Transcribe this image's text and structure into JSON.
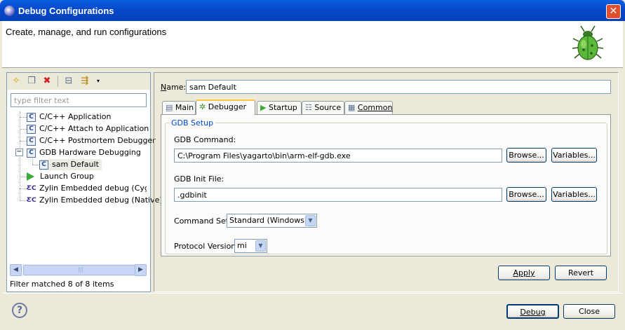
{
  "window": {
    "title": "Debug Configurations",
    "close_glyph": "✕"
  },
  "header": {
    "title": "Create, manage, and run configurations"
  },
  "left": {
    "filter_placeholder": "type filter text",
    "tree": [
      {
        "label": "C/C++ Application",
        "icon": "c-app-icon"
      },
      {
        "label": "C/C++ Attach to Application",
        "icon": "c-app-icon"
      },
      {
        "label": "C/C++ Postmortem Debugger",
        "icon": "c-app-icon"
      },
      {
        "label": "GDB Hardware Debugging",
        "icon": "c-app-icon",
        "expanded": true
      },
      {
        "label": "sam Default",
        "icon": "c-app-icon",
        "selected": true
      },
      {
        "label": "Launch Group",
        "icon": "launch-group-icon"
      },
      {
        "label": "Zylin Embedded debug (Cygwin)",
        "icon": "zylin-icon"
      },
      {
        "label": "Zylin Embedded debug (Native)",
        "icon": "zylin-icon"
      }
    ],
    "status": "Filter matched 8 of 8 items"
  },
  "right": {
    "name_label": "Name:",
    "name_value": "sam Default",
    "tabs": [
      {
        "label": "Main"
      },
      {
        "label": "Debugger",
        "active": true
      },
      {
        "label": "Startup"
      },
      {
        "label": "Source"
      },
      {
        "label": "Common"
      }
    ],
    "group_title": "GDB Setup",
    "gdb_command_label": "GDB Command:",
    "gdb_command_value": "C:\\Program Files\\yagarto\\bin\\arm-elf-gdb.exe",
    "gdb_init_label": "GDB Init File:",
    "gdb_init_value": ".gdbinit",
    "browse_label": "Browse...",
    "variables_label": "Variables...",
    "command_set_label": "Command Set:",
    "command_set_value": "Standard (Windows)",
    "protocol_label": "Protocol Version:",
    "protocol_value": "mi",
    "apply_label": "Apply",
    "revert_label": "Revert"
  },
  "footer": {
    "help_glyph": "?",
    "debug_label": "Debug",
    "close_label": "Close"
  }
}
